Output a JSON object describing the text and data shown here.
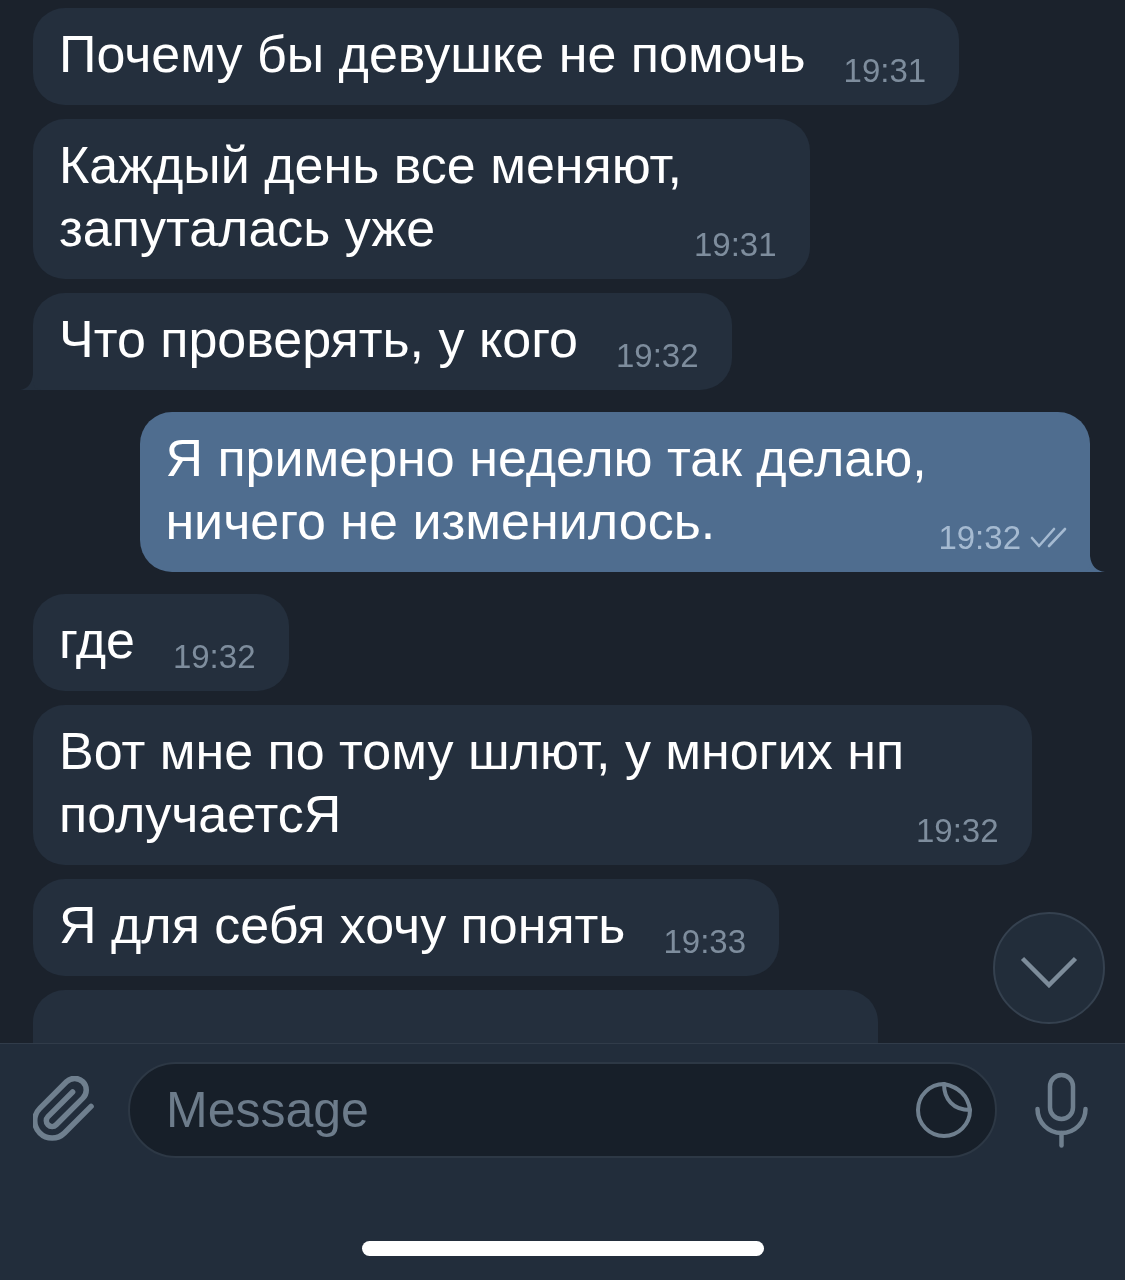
{
  "messages": [
    {
      "kind": "incoming",
      "text": "Почему бы девушке не помочь",
      "time": "19:31"
    },
    {
      "kind": "incoming",
      "text": "Каждый день все меняют, запуталась уже",
      "time": "19:31"
    },
    {
      "kind": "incoming",
      "text": "Что проверять, у кого",
      "time": "19:32"
    },
    {
      "kind": "outgoing",
      "text": "Я примерно неделю так делаю, ничего не изменилось.",
      "time": "19:32",
      "read": true
    },
    {
      "kind": "incoming",
      "text": "где",
      "time": "19:32"
    },
    {
      "kind": "incoming",
      "text": "Вот мне по тому шлют, у многих нп получаетсЯ",
      "time": "19:32"
    },
    {
      "kind": "incoming",
      "text": "Я для себя хочу понять",
      "time": "19:33"
    },
    {
      "kind": "incoming"
    }
  ],
  "composer": {
    "placeholder": "Message"
  }
}
